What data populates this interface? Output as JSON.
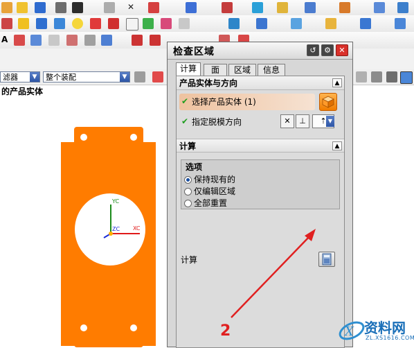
{
  "filter": {
    "left_value": "滤器",
    "right_value": "整个装配"
  },
  "view_title": "的产品实体",
  "dialog": {
    "title": "检查区域",
    "tabs": [
      "计算",
      "面",
      "区域",
      "信息"
    ],
    "section1": {
      "header": "产品实体与方向",
      "step_select": "选择产品实体 (1)",
      "step_direction": "指定脱模方向"
    },
    "section2": {
      "header": "计算",
      "options_title": "选项",
      "options": [
        "保持现有的",
        "仅编辑区域",
        "全部重置"
      ],
      "selected_option": 0,
      "calc_label": "计算"
    }
  },
  "viewport": {
    "axis_yc": "YC",
    "axis_xc": "XC",
    "axis_zc": "ZC"
  },
  "annotation": {
    "number": "2"
  },
  "watermark": {
    "brand": "资料网",
    "url": "ZL.XS1616.COM"
  },
  "colors": {
    "part": "#ff7c00",
    "accent": "#e02020"
  }
}
